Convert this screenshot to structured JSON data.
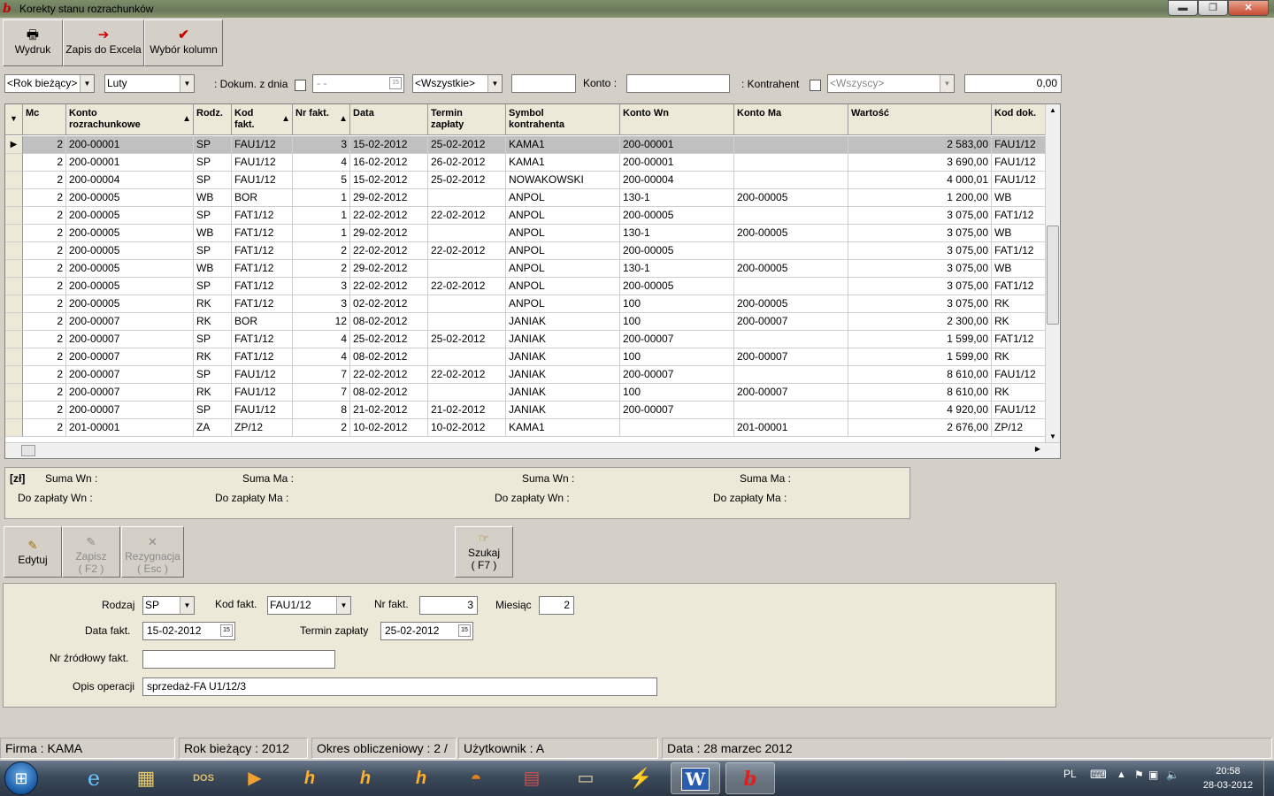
{
  "window": {
    "title": "Korekty stanu rozrachunków",
    "min": "▬",
    "max": "❐",
    "close": "✕"
  },
  "toolbar": {
    "print": "Wydruk",
    "excel": "Zapis do Excela",
    "columns": "Wybór kolumn"
  },
  "filters": {
    "year": "<Rok bieżący>",
    "month": "Luty",
    "dokum_label": ": Dokum. z dnia",
    "date": " -  -",
    "type": "<Wszystkie>",
    "code": "",
    "konto_label": "Konto :",
    "konto": "",
    "kontrahent_label": ": Kontrahent",
    "kontrahent": "<Wszyscy>",
    "amount": "0,00"
  },
  "grid": {
    "headers": {
      "mc": "Mc",
      "konto1": "Konto",
      "konto2": "rozrachunkowe",
      "rodz": "Rodz.",
      "kod1": "Kod",
      "kod2": "fakt.",
      "nr": "Nr fakt.",
      "data": "Data",
      "termin1": "Termin",
      "termin2": "zapłaty",
      "symbol1": "Symbol",
      "symbol2": "kontrahenta",
      "wn": "Konto Wn",
      "ma": "Konto Ma",
      "wartosc": "Wartość",
      "koddok": "Kod dok."
    },
    "rows": [
      [
        "2",
        "200-00001",
        "SP",
        "FAU1/12",
        "3",
        "15-02-2012",
        "25-02-2012",
        "KAMA1",
        "200-00001",
        "",
        "2 583,00",
        "FAU1/12"
      ],
      [
        "2",
        "200-00001",
        "SP",
        "FAU1/12",
        "4",
        "16-02-2012",
        "26-02-2012",
        "KAMA1",
        "200-00001",
        "",
        "3 690,00",
        "FAU1/12"
      ],
      [
        "2",
        "200-00004",
        "SP",
        "FAU1/12",
        "5",
        "15-02-2012",
        "25-02-2012",
        "NOWAKOWSKI",
        "200-00004",
        "",
        "4 000,01",
        "FAU1/12"
      ],
      [
        "2",
        "200-00005",
        "WB",
        "BOR",
        "1",
        "29-02-2012",
        "",
        "ANPOL",
        "130-1",
        "200-00005",
        "1 200,00",
        "WB"
      ],
      [
        "2",
        "200-00005",
        "SP",
        "FAT1/12",
        "1",
        "22-02-2012",
        "22-02-2012",
        "ANPOL",
        "200-00005",
        "",
        "3 075,00",
        "FAT1/12"
      ],
      [
        "2",
        "200-00005",
        "WB",
        "FAT1/12",
        "1",
        "29-02-2012",
        "",
        "ANPOL",
        "130-1",
        "200-00005",
        "3 075,00",
        "WB"
      ],
      [
        "2",
        "200-00005",
        "SP",
        "FAT1/12",
        "2",
        "22-02-2012",
        "22-02-2012",
        "ANPOL",
        "200-00005",
        "",
        "3 075,00",
        "FAT1/12"
      ],
      [
        "2",
        "200-00005",
        "WB",
        "FAT1/12",
        "2",
        "29-02-2012",
        "",
        "ANPOL",
        "130-1",
        "200-00005",
        "3 075,00",
        "WB"
      ],
      [
        "2",
        "200-00005",
        "SP",
        "FAT1/12",
        "3",
        "22-02-2012",
        "22-02-2012",
        "ANPOL",
        "200-00005",
        "",
        "3 075,00",
        "FAT1/12"
      ],
      [
        "2",
        "200-00005",
        "RK",
        "FAT1/12",
        "3",
        "02-02-2012",
        "",
        "ANPOL",
        "100",
        "200-00005",
        "3 075,00",
        "RK"
      ],
      [
        "2",
        "200-00007",
        "RK",
        "BOR",
        "12",
        "08-02-2012",
        "",
        "JANIAK",
        "100",
        "200-00007",
        "2 300,00",
        "RK"
      ],
      [
        "2",
        "200-00007",
        "SP",
        "FAT1/12",
        "4",
        "25-02-2012",
        "25-02-2012",
        "JANIAK",
        "200-00007",
        "",
        "1 599,00",
        "FAT1/12"
      ],
      [
        "2",
        "200-00007",
        "RK",
        "FAT1/12",
        "4",
        "08-02-2012",
        "",
        "JANIAK",
        "100",
        "200-00007",
        "1 599,00",
        "RK"
      ],
      [
        "2",
        "200-00007",
        "SP",
        "FAU1/12",
        "7",
        "22-02-2012",
        "22-02-2012",
        "JANIAK",
        "200-00007",
        "",
        "8 610,00",
        "FAU1/12"
      ],
      [
        "2",
        "200-00007",
        "RK",
        "FAU1/12",
        "7",
        "08-02-2012",
        "",
        "JANIAK",
        "100",
        "200-00007",
        "8 610,00",
        "RK"
      ],
      [
        "2",
        "200-00007",
        "SP",
        "FAU1/12",
        "8",
        "21-02-2012",
        "21-02-2012",
        "JANIAK",
        "200-00007",
        "",
        "4 920,00",
        "FAU1/12"
      ],
      [
        "2",
        "201-00001",
        "ZA",
        "ZP/12",
        "2",
        "10-02-2012",
        "10-02-2012",
        "KAMA1",
        "",
        "201-00001",
        "2 676,00",
        "ZP/12"
      ]
    ]
  },
  "sums": {
    "currency": "[zł]",
    "suma_wn": "Suma Wn :",
    "suma_ma": "Suma Ma :",
    "do_zaplaty_wn": "Do zapłaty Wn :",
    "do_zaplaty_ma": "Do zapłaty Ma :"
  },
  "actions": {
    "edit": "Edytuj",
    "save1": "Zapisz",
    "save2": "( F2 )",
    "cancel1": "Rezygnacja",
    "cancel2": "( Esc )",
    "search1": "Szukaj",
    "search2": "( F7 )"
  },
  "detail": {
    "rodzaj_label": "Rodzaj",
    "rodzaj": "SP",
    "kod_label": "Kod fakt.",
    "kod": "FAU1/12",
    "nr_label": "Nr fakt.",
    "nr": "3",
    "miesiac_label": "Miesiąc",
    "miesiac": "2",
    "data_label": "Data fakt.",
    "data": "15-02-2012",
    "termin_label": "Termin zapłaty",
    "termin": "25-02-2012",
    "zrodlowy_label": "Nr źródłowy fakt.",
    "zrodlowy": "",
    "opis_label": "Opis operacji",
    "opis": "sprzedaż-FA U1/12/3"
  },
  "status": {
    "firma": "Firma : KAMA",
    "rok": "Rok bieżący : 2012",
    "okres": "Okres obliczeniowy : 2 /",
    "user": "Użytkownik : A",
    "data": "Data : 28 marzec 2012"
  },
  "tray": {
    "lang": "PL",
    "time": "20:58",
    "date": "28-03-2012"
  }
}
